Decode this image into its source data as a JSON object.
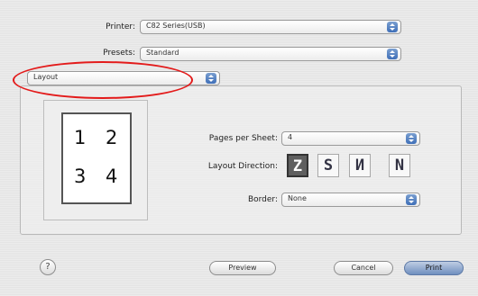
{
  "printer": {
    "label": "Printer:",
    "value": "C82 Series(USB)"
  },
  "presets": {
    "label": "Presets:",
    "value": "Standard"
  },
  "panel_menu": {
    "value": "Layout"
  },
  "preview": {
    "pages": [
      "1",
      "2",
      "3",
      "4"
    ]
  },
  "pages_per_sheet": {
    "label": "Pages per Sheet:",
    "value": "4"
  },
  "layout_direction": {
    "label": "Layout Direction:",
    "buttons": [
      {
        "glyph": "Z",
        "selected": true
      },
      {
        "glyph": "S",
        "selected": false
      },
      {
        "glyph": "N",
        "selected": false
      },
      {
        "glyph": "N",
        "selected": false
      }
    ]
  },
  "border": {
    "label": "Border:",
    "value": "None"
  },
  "footer": {
    "help": "?",
    "preview": "Preview",
    "cancel": "Cancel",
    "print": "Print"
  },
  "colors": {
    "highlight_ellipse": "#e31b1b",
    "accent": "#3f6fb8"
  }
}
